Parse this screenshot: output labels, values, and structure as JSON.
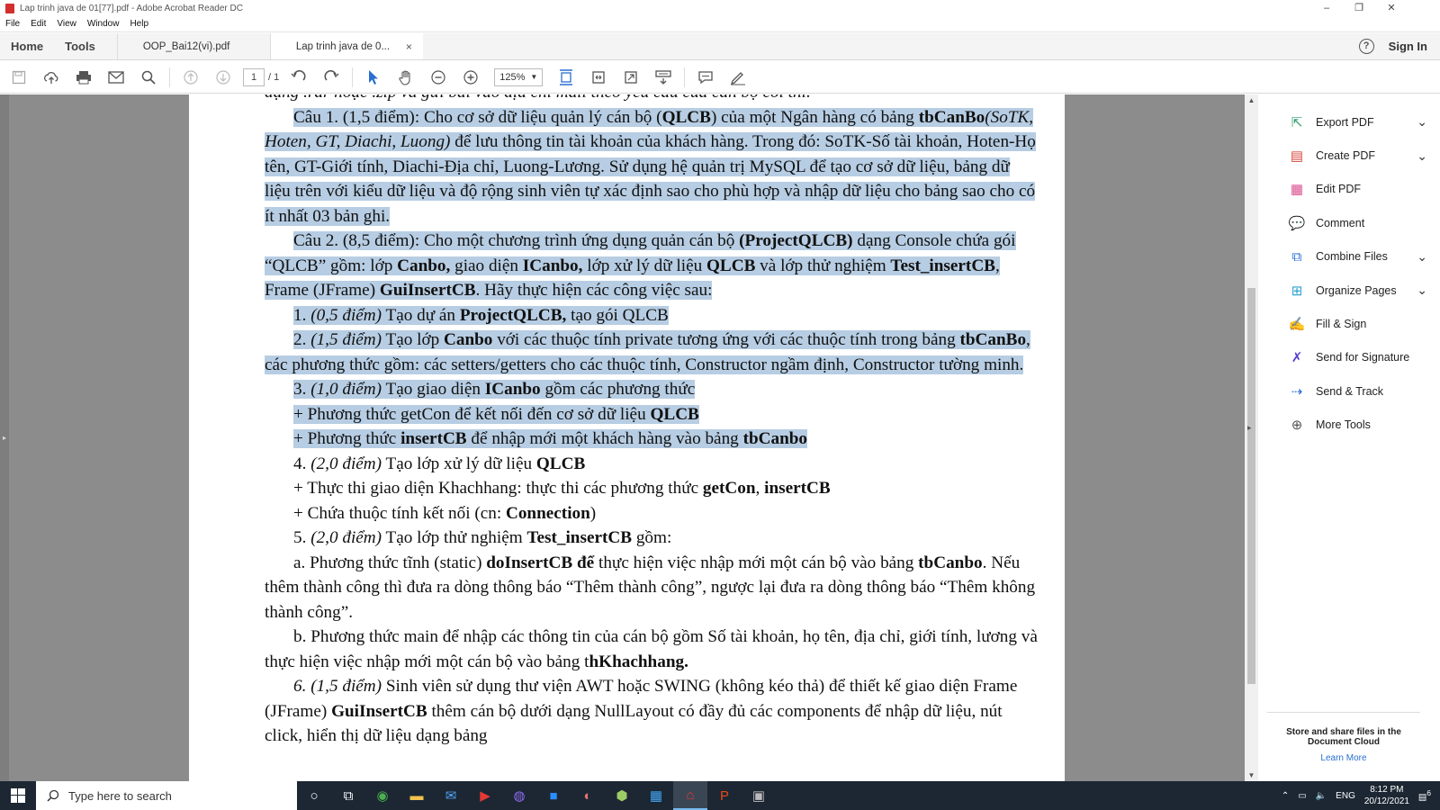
{
  "window": {
    "title": "Lap trinh java de 01[77].pdf - Adobe Acrobat Reader DC",
    "minimize": "–",
    "restore": "❐",
    "close": "✕"
  },
  "menu": [
    "File",
    "Edit",
    "View",
    "Window",
    "Help"
  ],
  "tabs": {
    "home": "Home",
    "tools": "Tools",
    "docs": [
      {
        "label": "OOP_Bai12(vi).pdf",
        "active": false
      },
      {
        "label": "Lap trinh java de 0...",
        "active": true
      }
    ],
    "close_glyph": "×",
    "sign_in": "Sign In",
    "help": "?"
  },
  "toolbar": {
    "page_current": "1",
    "page_total": "/ 1",
    "zoom": "125%"
  },
  "document": {
    "top_fragment": "dạng .rar hoặc .zip và gửi bài vào địa chỉ mail theo yêu cầu của cán bộ coi thi.",
    "paragraphs": [
      {
        "html": "Câu 1. (1,5 điểm): Cho cơ sở dữ liệu quản lý cán bộ (<b>QLCB</b>) của một Ngân hàng có bảng <b>tbCanBo</b><i>(SoTK, Hoten, GT, Diachi, Luong)</i> để lưu thông tin tài khoản của khách hàng. Trong đó: SoTK-Số tài khoản, Hoten-Họ tên, GT-Giới tính, Diachi-Địa chỉ, Luong-Lương. Sử dụng hệ quản trị MySQL để tạo cơ sở dữ liệu, bảng dữ liệu trên với kiểu dữ liệu và độ rộng sinh viên tự xác định sao cho phù hợp và nhập dữ liệu cho bảng sao cho có ít nhất 03 bản ghi.",
        "highlight": true
      },
      {
        "html": "Câu 2. (8,5 điểm): Cho một chương trình ứng dụng quản cán bộ <b>(ProjectQLCB)</b> dạng Console chứa gói “QLCB” gồm: lớp <b>Canbo,</b> giao diện <b>ICanbo,</b> lớp xử lý dữ liệu <b>QLCB</b> và lớp thử nghiệm <b>Test_insertCB</b>, Frame (JFrame) <b>GuiInsertCB</b>. Hãy thực hiện các công việc sau:",
        "highlight": true
      },
      {
        "html": "1. <i>(0,5 điểm)</i> Tạo dự án <b>ProjectQLCB,</b> tạo gói QLCB",
        "highlight": true
      },
      {
        "html": "2. <i>(1,5 điểm)</i> Tạo lớp <b>Canbo</b> với các thuộc tính private tương ứng với các thuộc tính trong bảng <b>tbCanBo</b>, các phương thức gồm: các setters/getters cho các thuộc tính, Constructor ngầm định, Constructor tường minh.",
        "highlight": true
      },
      {
        "html": "3. <i>(1,0 điểm)</i> Tạo giao diện <b>ICanbo</b> gồm các phương thức",
        "highlight": true
      },
      {
        "html": "+ Phương thức getCon để kết nối đến cơ sở dữ liệu <b>QLCB</b>",
        "highlight": true
      },
      {
        "html": "+ Phương thức <b>insertCB</b> để nhập mới một khách hàng vào bảng <b>tbCanbo</b>",
        "highlight": true
      },
      {
        "html": "4. <i>(2,0 điểm)</i> Tạo lớp xử lý dữ liệu <b>QLCB</b>",
        "highlight": false
      },
      {
        "html": "+ Thực thi giao diện Khachhang: thực thi các phương thức <b>getCon</b>, <b>insertCB</b>",
        "highlight": false
      },
      {
        "html": "+ Chứa thuộc tính kết nối (cn: <b>Connection</b>)",
        "highlight": false
      },
      {
        "html": "5. <i>(2,0 điểm)</i> Tạo lớp thử nghiệm <b>Test_insertCB</b> gồm:",
        "highlight": false
      },
      {
        "html": "a. Phương thức tĩnh (static) <b>doInsertCB để</b> thực hiện việc nhập mới một cán bộ vào bảng <b>tbCanbo</b>. Nếu thêm thành công thì đưa ra dòng thông báo “Thêm thành công”, ngược lại đưa ra dòng thông báo “Thêm không thành công”.",
        "highlight": false
      },
      {
        "html": "b. Phương thức main để nhập các thông tin của cán bộ gồm Số tài khoản, họ tên, địa chỉ, giới tính, lương và thực hiện việc nhập mới một cán bộ vào bảng t<b>hKhachhang.</b>",
        "highlight": false
      },
      {
        "html": "<i>6. (1,5 điểm)</i> Sinh viên sử dụng thư viện AWT hoặc SWING (không kéo thả) để thiết kế giao diện Frame (JFrame) <b>GuiInsertCB</b> thêm cán bộ dưới dạng NullLayout có đầy đủ các components để nhập dữ liệu, nút click, hiển thị dữ liệu dạng bảng",
        "highlight": false
      }
    ]
  },
  "right_pane": {
    "tools": [
      {
        "label": "Export PDF",
        "icon": "export-pdf-icon",
        "glyph": "⇱",
        "color": "#2e9e6b",
        "chevron": true
      },
      {
        "label": "Create PDF",
        "icon": "create-pdf-icon",
        "glyph": "▤",
        "color": "#d9453d",
        "chevron": true
      },
      {
        "label": "Edit PDF",
        "icon": "edit-pdf-icon",
        "glyph": "▦",
        "color": "#d94e8f",
        "chevron": false
      },
      {
        "label": "Comment",
        "icon": "comment-icon",
        "glyph": "💬",
        "color": "#e8b32c",
        "chevron": false
      },
      {
        "label": "Combine Files",
        "icon": "combine-files-icon",
        "glyph": "⧉",
        "color": "#2a6fd1",
        "chevron": true
      },
      {
        "label": "Organize Pages",
        "icon": "organize-pages-icon",
        "glyph": "⊞",
        "color": "#2a9fd1",
        "chevron": true
      },
      {
        "label": "Fill & Sign",
        "icon": "fill-sign-icon",
        "glyph": "✍",
        "color": "#8a4fd1",
        "chevron": false
      },
      {
        "label": "Send for Signature",
        "icon": "send-signature-icon",
        "glyph": "✗",
        "color": "#5a3fd1",
        "chevron": false
      },
      {
        "label": "Send & Track",
        "icon": "send-track-icon",
        "glyph": "⇢",
        "color": "#2a6fd1",
        "chevron": false
      },
      {
        "label": "More Tools",
        "icon": "more-tools-icon",
        "glyph": "⊕",
        "color": "#555555",
        "chevron": false
      }
    ],
    "cloud_text": "Store and share files in the Document Cloud",
    "learn_more": "Learn More"
  },
  "taskbar": {
    "search_placeholder": "Type here to search",
    "tray_lang": "ENG",
    "time": "8:12 PM",
    "date": "20/12/2021",
    "notif_count": "6"
  }
}
